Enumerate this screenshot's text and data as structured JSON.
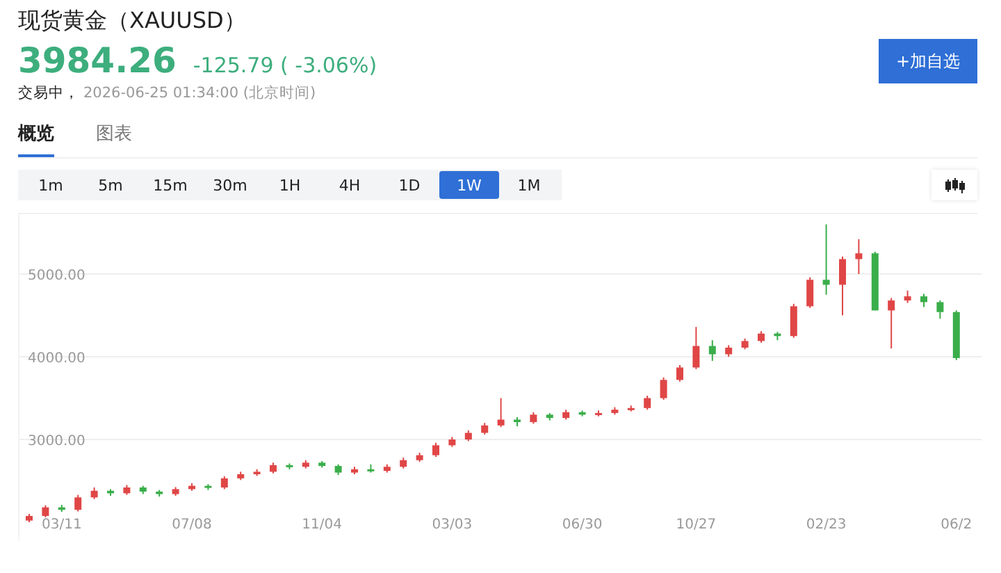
{
  "quote": {
    "name": "现货黄金（XAUUSD）",
    "price": "3984.26",
    "change": "-125.79 ( -3.06%)",
    "status": "交易中，",
    "time": "2026-06-25 01:34:00 (北京时间)"
  },
  "watch_button": "+加自选",
  "tabs": [
    {
      "label": "概览",
      "selected": true
    },
    {
      "label": "图表",
      "selected": false
    }
  ],
  "periods": [
    {
      "label": "1m",
      "selected": false
    },
    {
      "label": "5m",
      "selected": false
    },
    {
      "label": "15m",
      "selected": false
    },
    {
      "label": "30m",
      "selected": false
    },
    {
      "label": "1H",
      "selected": false
    },
    {
      "label": "4H",
      "selected": false
    },
    {
      "label": "1D",
      "selected": false
    },
    {
      "label": "1W",
      "selected": true
    },
    {
      "label": "1M",
      "selected": false
    }
  ],
  "chart": {
    "chart_data": {
      "type": "candlestick",
      "categories": [
        null,
        null,
        "03/11",
        null,
        null,
        null,
        null,
        null,
        null,
        null,
        "07/08",
        null,
        null,
        null,
        null,
        null,
        null,
        null,
        "11/04",
        null,
        null,
        null,
        null,
        null,
        null,
        null,
        "03/03",
        null,
        null,
        null,
        null,
        null,
        null,
        null,
        "06/30",
        null,
        null,
        null,
        null,
        null,
        null,
        "10/27",
        null,
        null,
        null,
        null,
        null,
        null,
        null,
        "02/23",
        null,
        null,
        null,
        null,
        null,
        null,
        null,
        "06/2"
      ],
      "ohlc": [
        [
          2020,
          2100,
          2000,
          2076
        ],
        [
          2076,
          2205,
          2060,
          2180
        ],
        [
          2180,
          2210,
          2125,
          2150
        ],
        [
          2150,
          2330,
          2130,
          2300
        ],
        [
          2300,
          2420,
          2280,
          2380
        ],
        [
          2380,
          2400,
          2320,
          2350
        ],
        [
          2350,
          2450,
          2330,
          2420
        ],
        [
          2420,
          2440,
          2340,
          2370
        ],
        [
          2370,
          2390,
          2310,
          2340
        ],
        [
          2340,
          2425,
          2320,
          2400
        ],
        [
          2400,
          2470,
          2380,
          2440
        ],
        [
          2440,
          2460,
          2390,
          2420
        ],
        [
          2420,
          2555,
          2400,
          2530
        ],
        [
          2530,
          2610,
          2510,
          2580
        ],
        [
          2580,
          2640,
          2560,
          2610
        ],
        [
          2610,
          2720,
          2590,
          2690
        ],
        [
          2690,
          2710,
          2640,
          2670
        ],
        [
          2670,
          2750,
          2650,
          2720
        ],
        [
          2720,
          2740,
          2660,
          2680
        ],
        [
          2680,
          2700,
          2570,
          2600
        ],
        [
          2600,
          2670,
          2580,
          2640
        ],
        [
          2640,
          2700,
          2600,
          2620
        ],
        [
          2620,
          2700,
          2600,
          2670
        ],
        [
          2670,
          2780,
          2650,
          2750
        ],
        [
          2750,
          2840,
          2730,
          2810
        ],
        [
          2810,
          2960,
          2790,
          2930
        ],
        [
          2930,
          3030,
          2910,
          3000
        ],
        [
          3000,
          3110,
          2980,
          3080
        ],
        [
          3080,
          3200,
          3060,
          3170
        ],
        [
          3170,
          3500,
          3150,
          3240
        ],
        [
          3240,
          3270,
          3160,
          3210
        ],
        [
          3210,
          3330,
          3190,
          3300
        ],
        [
          3300,
          3320,
          3230,
          3260
        ],
        [
          3260,
          3360,
          3240,
          3330
        ],
        [
          3330,
          3350,
          3280,
          3300
        ],
        [
          3300,
          3350,
          3280,
          3320
        ],
        [
          3320,
          3390,
          3300,
          3360
        ],
        [
          3360,
          3410,
          3340,
          3380
        ],
        [
          3380,
          3530,
          3360,
          3500
        ],
        [
          3500,
          3750,
          3480,
          3720
        ],
        [
          3720,
          3900,
          3700,
          3870
        ],
        [
          3870,
          4360,
          3850,
          4130
        ],
        [
          4130,
          4200,
          3950,
          4030
        ],
        [
          4030,
          4140,
          4000,
          4110
        ],
        [
          4110,
          4220,
          4090,
          4190
        ],
        [
          4190,
          4310,
          4170,
          4280
        ],
        [
          4280,
          4300,
          4200,
          4250
        ],
        [
          4250,
          4640,
          4230,
          4610
        ],
        [
          4610,
          4960,
          4590,
          4930
        ],
        [
          4930,
          5600,
          4750,
          4870
        ],
        [
          4870,
          5210,
          4500,
          5180
        ],
        [
          5180,
          5420,
          5000,
          5250
        ],
        [
          5250,
          5270,
          4560,
          4560
        ],
        [
          4560,
          4710,
          4100,
          4680
        ],
        [
          4680,
          4800,
          4650,
          4730
        ],
        [
          4730,
          4760,
          4600,
          4660
        ],
        [
          4660,
          4680,
          4460,
          4540
        ],
        [
          4540,
          4560,
          3960,
          3984
        ]
      ],
      "ylim": [
        1773,
        5723
      ],
      "grid": true,
      "yticks": [
        {
          "value": 5000,
          "label": "5000.00"
        },
        {
          "value": 4000,
          "label": "4000.00"
        },
        {
          "value": 3000,
          "label": "3000.00"
        }
      ]
    }
  }
}
